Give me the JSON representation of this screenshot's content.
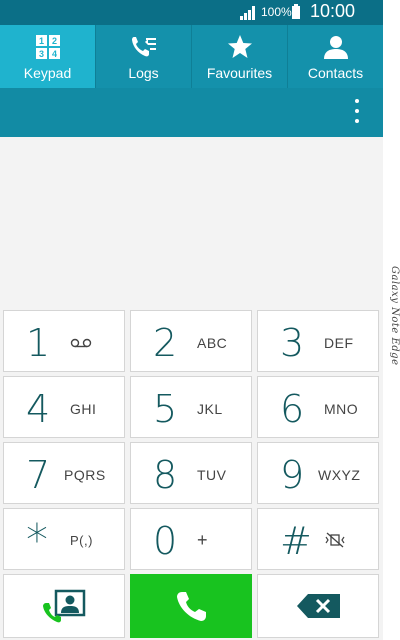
{
  "status": {
    "battery_percent": "100%",
    "clock": "10:00"
  },
  "tabs": [
    {
      "label": "Keypad",
      "icon": "keypad-icon",
      "active": true
    },
    {
      "label": "Logs",
      "icon": "logs-icon",
      "active": false
    },
    {
      "label": "Favourites",
      "icon": "star-icon",
      "active": false
    },
    {
      "label": "Contacts",
      "icon": "contact-icon",
      "active": false
    }
  ],
  "keypad_icon_digits": [
    "1",
    "2",
    "3",
    "4"
  ],
  "keys": [
    {
      "digit": "1",
      "letters": "",
      "symbol": "voicemail-icon"
    },
    {
      "digit": "2",
      "letters": "ABC"
    },
    {
      "digit": "3",
      "letters": "DEF"
    },
    {
      "digit": "4",
      "letters": "GHI"
    },
    {
      "digit": "5",
      "letters": "JKL"
    },
    {
      "digit": "6",
      "letters": "MNO"
    },
    {
      "digit": "7",
      "letters": "PQRS"
    },
    {
      "digit": "8",
      "letters": "TUV"
    },
    {
      "digit": "9",
      "letters": "WXYZ"
    },
    {
      "digit": "*",
      "letters": "P(,)"
    },
    {
      "digit": "0",
      "letters": "+"
    },
    {
      "digit": "#",
      "letters": "",
      "symbol": "vibrate-mute-icon"
    }
  ],
  "edge_label": "Galaxy Note Edge",
  "colors": {
    "status_bar": "#0b6f87",
    "tab_bar": "#1491ab",
    "tab_active": "#1fb3ce",
    "action_bar": "#128ba4",
    "call_green": "#18c31f",
    "digit_text": "#14595f"
  }
}
